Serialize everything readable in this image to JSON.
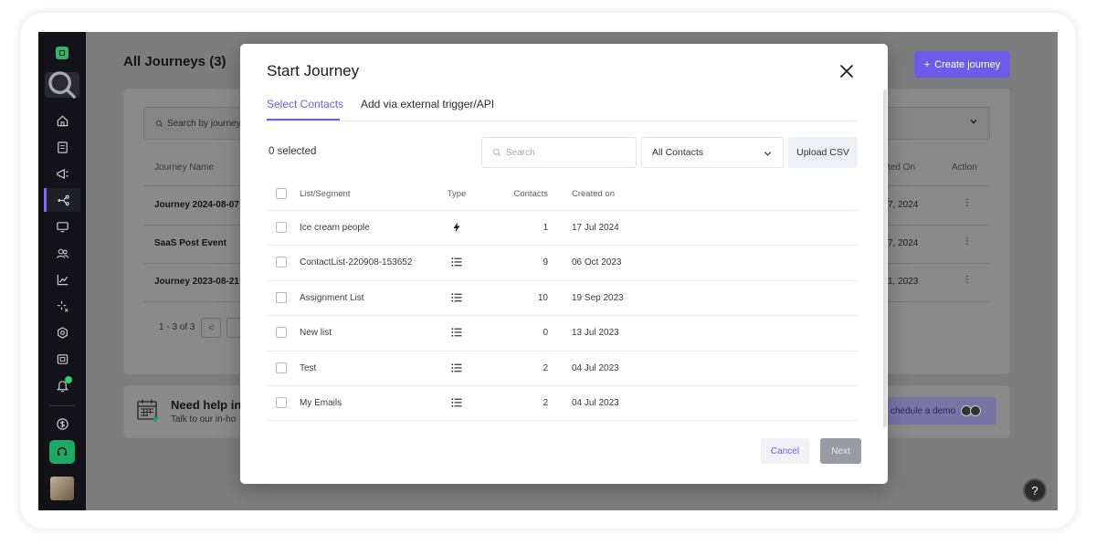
{
  "colors": {
    "accent": "#6c5ce7",
    "sidebar_bg": "#121218",
    "success": "#1ea866"
  },
  "sidebar": {
    "icons": [
      "logo-icon",
      "search-icon",
      "home-icon",
      "document-icon",
      "megaphone-icon",
      "journey-icon",
      "template-icon",
      "contacts-icon",
      "analytics-icon",
      "sparkle-icon",
      "settings-icon",
      "integrations-icon",
      "bell-icon",
      "billing-icon",
      "headset-icon",
      "avatar"
    ]
  },
  "background": {
    "title": "All Journeys (3)",
    "create_button": "Create journey",
    "search_placeholder": "Search by journey",
    "columns": {
      "name": "Journey Name",
      "created_on": "ted On",
      "action": "Action"
    },
    "rows": [
      {
        "name": "Journey 2024-08-07",
        "created": "7, 2024"
      },
      {
        "name": "SaaS Post Event",
        "created": "7, 2024"
      },
      {
        "name": "Journey 2023-08-21",
        "created": "1, 2023"
      }
    ],
    "pager": "1 - 3 of 3",
    "pager_prev": "<",
    "help_title": "Need help in",
    "help_subtitle": "Talk to our in-ho",
    "demo_button": "chedule a demo",
    "help_fab": "?"
  },
  "modal": {
    "title": "Start Journey",
    "tabs": [
      {
        "label": "Select Contacts",
        "active": true
      },
      {
        "label": "Add via external trigger/API",
        "active": false
      }
    ],
    "selected_count": "0 selected",
    "search_placeholder": "Search",
    "filter_value": "All Contacts",
    "upload_button": "Upload CSV",
    "table": {
      "headers": {
        "name": "List/Segment",
        "type": "Type",
        "contacts": "Contacts",
        "created": "Created on"
      },
      "rows": [
        {
          "name": "Ice cream people",
          "type": "segment",
          "contacts": "1",
          "created": "17 Jul 2024"
        },
        {
          "name": "ContactList-220908-153652",
          "type": "list",
          "contacts": "9",
          "created": "06 Oct 2023"
        },
        {
          "name": "Assignment List",
          "type": "list",
          "contacts": "10",
          "created": "19 Sep 2023"
        },
        {
          "name": "New list",
          "type": "list",
          "contacts": "0",
          "created": "13 Jul 2023"
        },
        {
          "name": "Test",
          "type": "list",
          "contacts": "2",
          "created": "04 Jul 2023"
        },
        {
          "name": "My Emails",
          "type": "list",
          "contacts": "2",
          "created": "04 Jul 2023"
        }
      ]
    },
    "cancel_button": "Cancel",
    "next_button": "Next"
  }
}
